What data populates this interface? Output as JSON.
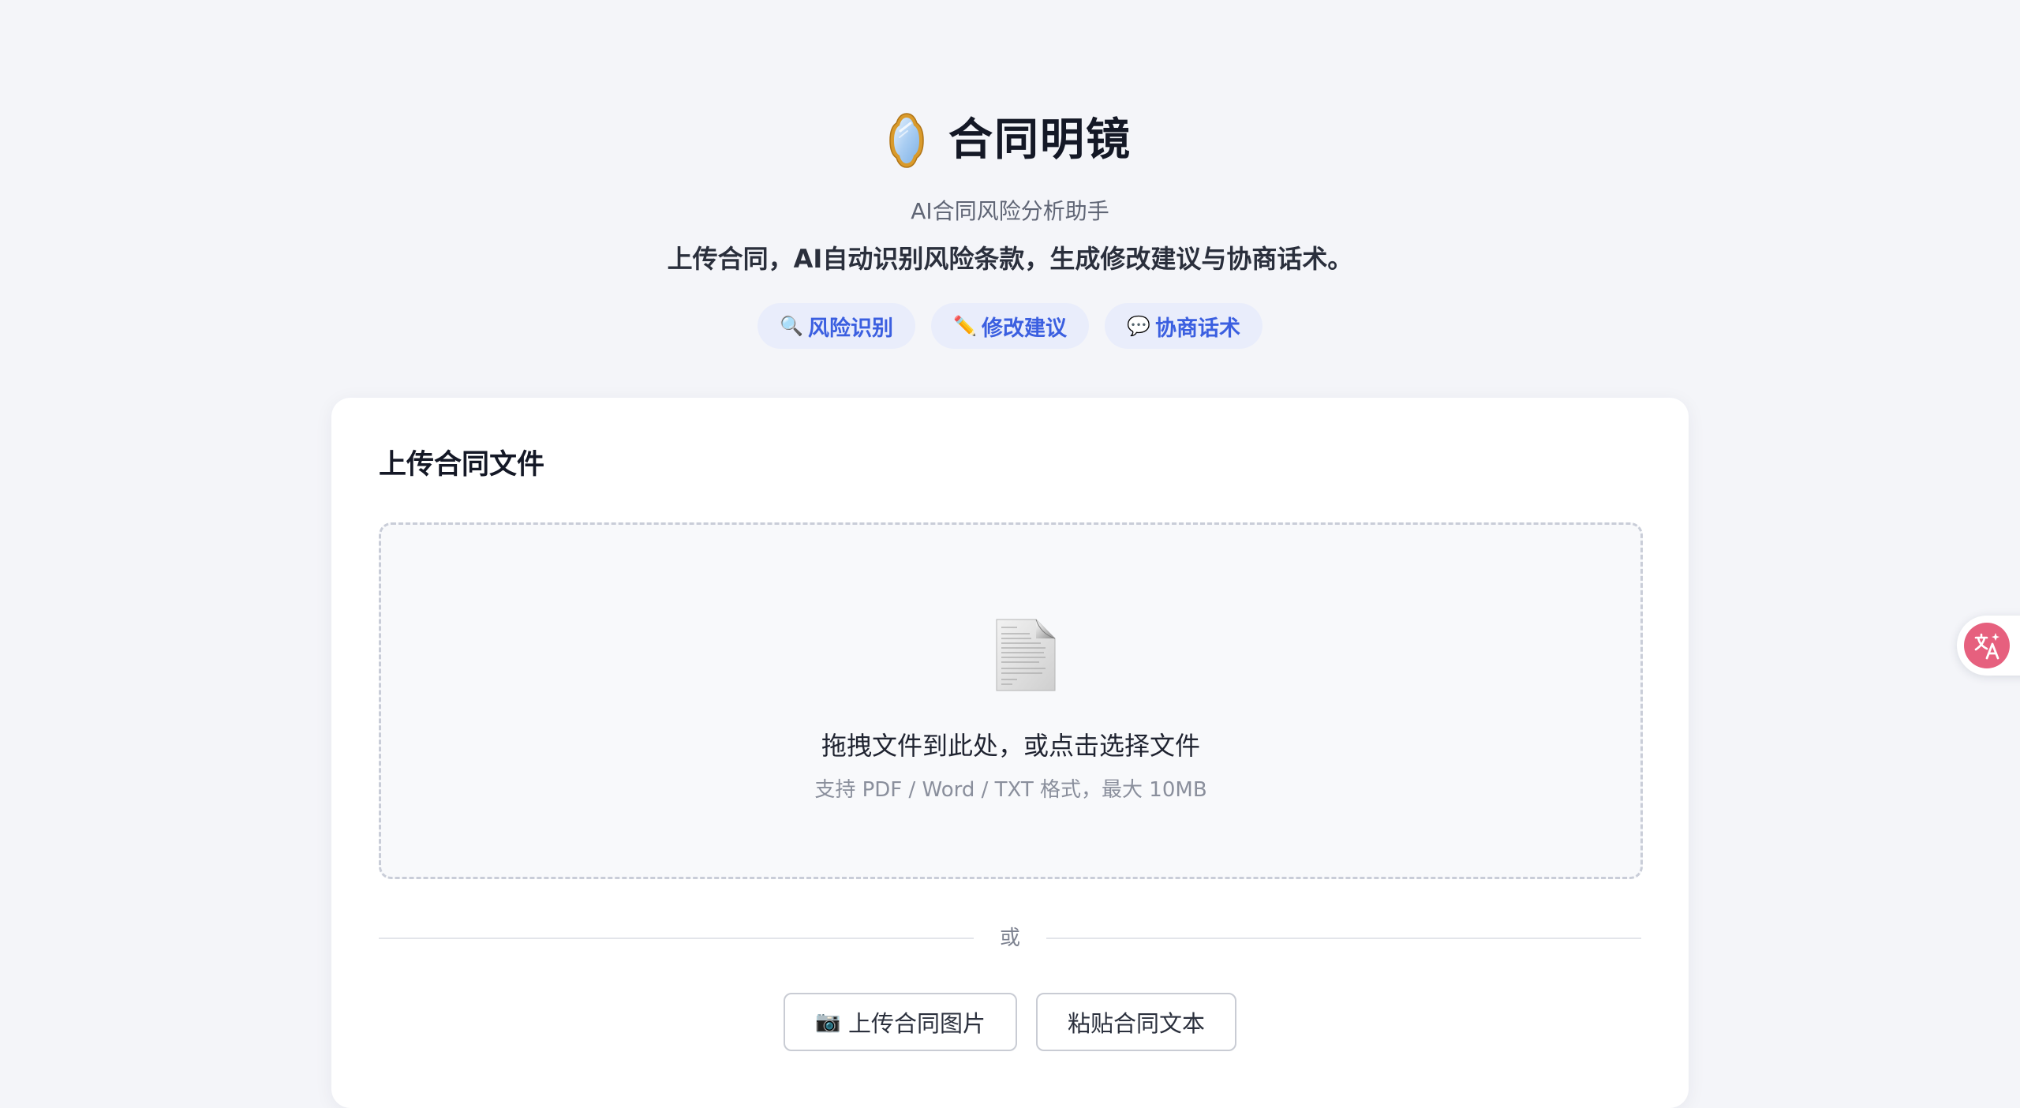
{
  "app": {
    "title": "合同明镜",
    "subtitle": "AI合同风险分析助手",
    "tagline": "上传合同，AI自动识别风险条款，生成修改建议与协商话术。",
    "logo_icon": "mirror-icon"
  },
  "features": [
    {
      "label": "风险识别",
      "icon": "magnifier-icon",
      "glyph": "🔍"
    },
    {
      "label": "修改建议",
      "icon": "pencil-icon",
      "glyph": "✏️"
    },
    {
      "label": "协商话术",
      "icon": "speech-bubble-icon",
      "glyph": "💬"
    }
  ],
  "upload": {
    "title": "上传合同文件",
    "drop_main": "拖拽文件到此处，或点击选择文件",
    "drop_sub": "支持 PDF / Word / TXT 格式，最大 10MB",
    "doc_icon": "document-icon",
    "divider_text": "或",
    "image_button": {
      "label": "上传合同图片",
      "icon": "camera-icon",
      "glyph": "📷"
    },
    "paste_button": {
      "label": "粘贴合同文本"
    }
  },
  "floating": {
    "translate_icon": "translate-icon"
  },
  "colors": {
    "background": "#f4f5f9",
    "accent": "#3b5fe0",
    "chip_bg": "#e9edfb",
    "translate_pink": "#e6607e"
  }
}
